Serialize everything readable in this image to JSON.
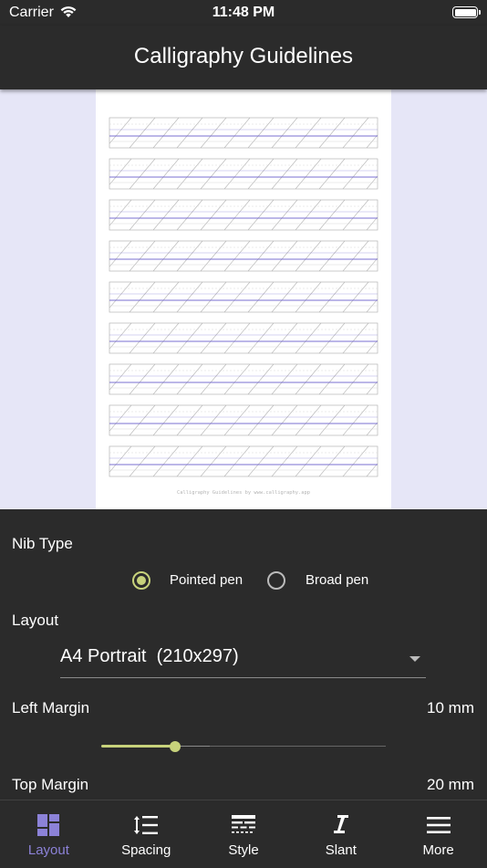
{
  "status_bar": {
    "carrier": "Carrier",
    "time": "11:48 PM"
  },
  "app_bar": {
    "title": "Calligraphy Guidelines"
  },
  "preview": {
    "footer_text": "Calligraphy Guidelines by www.calligraphy.app",
    "line_color": "#7a6fd0",
    "slant_line_color": "#b5b5b5"
  },
  "settings": {
    "nib_type": {
      "label": "Nib Type",
      "options": [
        "Pointed pen",
        "Broad pen"
      ],
      "selected": "Pointed pen"
    },
    "layout": {
      "label": "Layout",
      "value": "A4 Portrait  (210x297)"
    },
    "left_margin": {
      "label": "Left Margin",
      "value": "10 mm",
      "slider_fraction": 0.26,
      "slider_secondary_fraction": 0.38
    },
    "top_margin": {
      "label": "Top Margin",
      "value": "20 mm"
    }
  },
  "bottom_nav": {
    "items": [
      {
        "label": "Layout",
        "icon": "layout-icon",
        "active": true
      },
      {
        "label": "Spacing",
        "icon": "spacing-icon",
        "active": false
      },
      {
        "label": "Style",
        "icon": "style-icon",
        "active": false
      },
      {
        "label": "Slant",
        "icon": "slant-icon",
        "active": false
      },
      {
        "label": "More",
        "icon": "menu-icon",
        "active": false
      }
    ]
  },
  "colors": {
    "accent": "#c7d27b",
    "nav_active": "#8c82d8",
    "background": "#2b2b2b",
    "preview_background": "#e6e6f7"
  }
}
